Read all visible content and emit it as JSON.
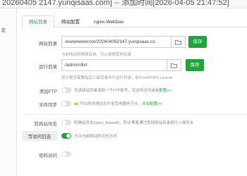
{
  "window": {
    "title": "20260405 2147.yunqisaas.com] -- 添加时间[2026-04-05 21:47:52]"
  },
  "sidebar": {
    "item_label": "定"
  },
  "tabs": [
    {
      "label": "网站目录"
    },
    {
      "label": "网站配置"
    },
    {
      "label": "nginx WebDav"
    }
  ],
  "site_dir": {
    "label": "网站目录",
    "value": "/www/wwwroot/202604052147.yunqisaas.co",
    "hint": "当前网站的根部目录，可以选择其他目录",
    "save": "保存"
  },
  "run_dir": {
    "label": "运行目录",
    "value": "/admin/dist",
    "hint": "部分程序需要指定二级目录作为运行目录，如ThinkPHP5,Laravel",
    "save": "保存"
  },
  "add_ftp": {
    "label": "添加FTP",
    "text": "为该网站目录添加一个FTP账号，仅支持访问",
    "link": "点击配置>>",
    "enabled": false
  },
  "file_sync": {
    "label": "文件同步",
    "text": "可以同步网站文件至其他服务节点，",
    "link": "点击配置>>",
    "enabled": false
  },
  "anti_xss": {
    "label": "防跨站攻击",
    "text": "防跨站攻击(open_basedir)，防止黑客通过其他网站目录进行入侵攻击",
    "enabled": false
  },
  "write_log": {
    "label": "写访问日志",
    "text": "允许当前网站的日志访问",
    "enabled": true
  },
  "password_access": {
    "label": "密码访问",
    "enabled": false
  },
  "colors": {
    "accent": "#20a53a"
  }
}
